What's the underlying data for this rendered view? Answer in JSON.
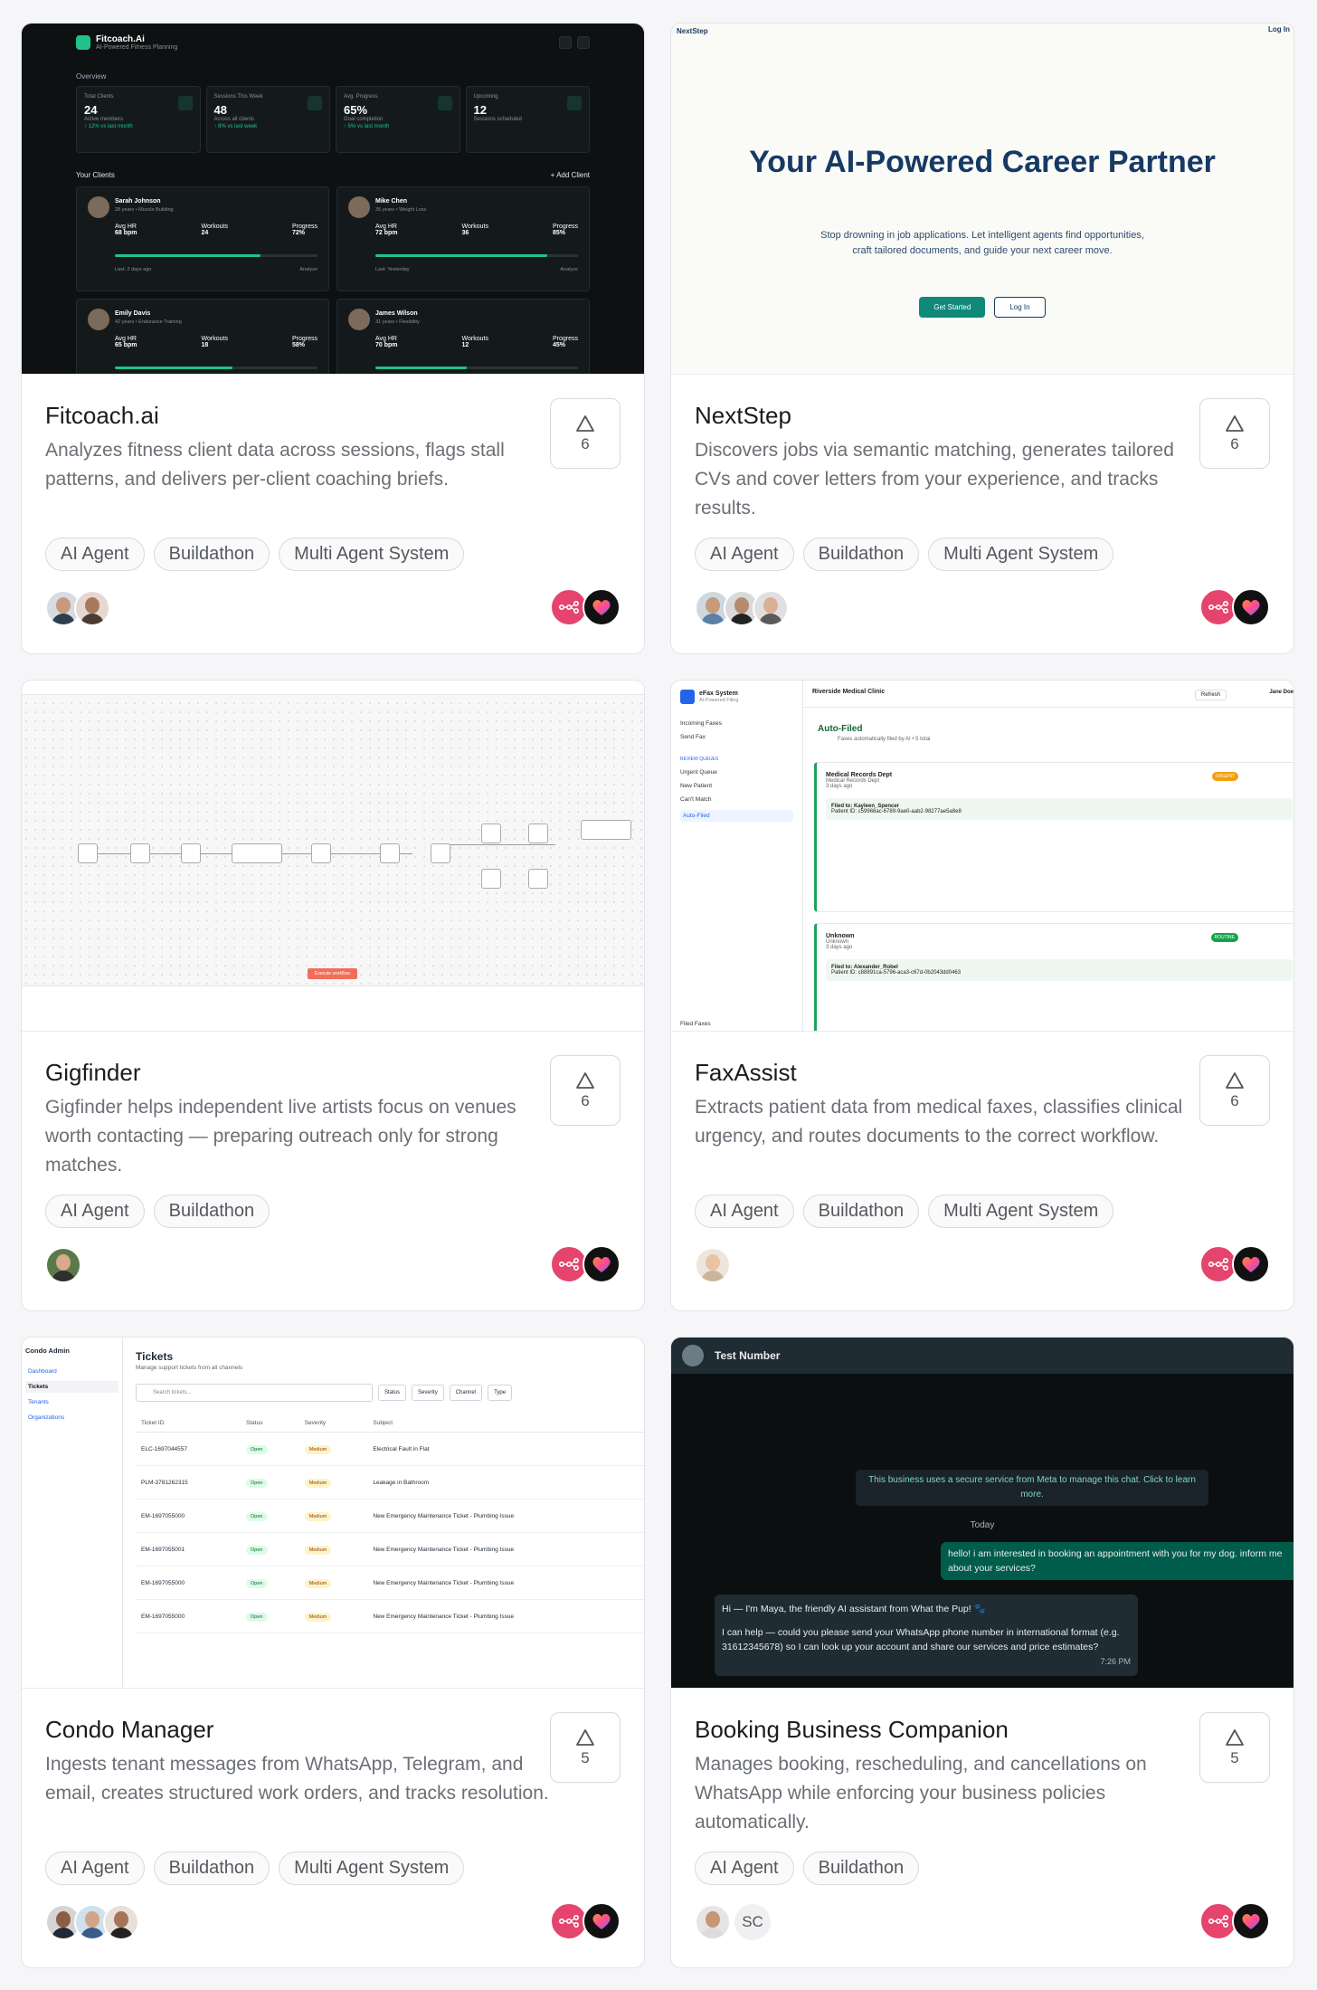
{
  "cards": [
    {
      "title": "Fitcoach.ai",
      "description": "Analyzes fitness client data across sessions, flags stall patterns, and delivers per-client coaching briefs.",
      "votes": "6",
      "tags": [
        "AI Agent",
        "Buildathon",
        "Multi Agent System"
      ],
      "shot": {
        "brand": "Fitcoach.Ai",
        "brand_sub": "AI-Powered Fitness Planning",
        "section": "Overview",
        "stats": [
          {
            "label": "Total Clients",
            "value": "24",
            "sub": "Active members",
            "trend": "↑ 12% vs last month"
          },
          {
            "label": "Sessions This Week",
            "value": "48",
            "sub": "Across all clients",
            "trend": "↑ 8% vs last week"
          },
          {
            "label": "Avg. Progress",
            "value": "65%",
            "sub": "Goal completion",
            "trend": "↑ 5% vs last month"
          },
          {
            "label": "Upcoming",
            "value": "12",
            "sub": "Sessions scheduled",
            "trend": ""
          }
        ],
        "clients_title": "Your Clients",
        "add_client": "+ Add Client",
        "clients": [
          {
            "name": "Sarah Johnson",
            "info": "28 years • Muscle Building",
            "hr": "68 bpm",
            "workouts": "24",
            "progress": "72%",
            "progress_value": 0.72,
            "last": "Last: 2 days ago"
          },
          {
            "name": "Mike Chen",
            "info": "35 years • Weight Loss",
            "hr": "72 bpm",
            "workouts": "36",
            "progress": "85%",
            "progress_value": 0.85,
            "last": "Last: Yesterday"
          },
          {
            "name": "Emily Davis",
            "info": "42 years • Endurance Training",
            "hr": "65 bpm",
            "workouts": "18",
            "progress": "58%",
            "progress_value": 0.58,
            "last": ""
          },
          {
            "name": "James Wilson",
            "info": "31 years • Flexibility",
            "hr": "70 bpm",
            "workouts": "12",
            "progress": "45%",
            "progress_value": 0.45,
            "last": ""
          }
        ],
        "labels": {
          "hr": "Avg HR",
          "workouts": "Workouts",
          "progress": "Progress",
          "analyze": "Analyze"
        }
      }
    },
    {
      "title": "NextStep",
      "description": "Discovers jobs via semantic matching, generates tailored CVs and cover letters from your experience, and tracks results.",
      "votes": "6",
      "tags": [
        "AI Agent",
        "Buildathon",
        "Multi Agent System"
      ],
      "shot": {
        "logo": "NextStep",
        "login_link": "Log In",
        "headline": "Your AI-Powered Career Partner",
        "subtext": "Stop drowning in job applications. Let intelligent agents find opportunities, craft tailored documents, and guide your next career move.",
        "primary": "Get Started",
        "secondary": "Log In"
      }
    },
    {
      "title": "Gigfinder",
      "description": "Gigfinder helps independent live artists focus on venues worth contacting — preparing outreach only for strong matches.",
      "votes": "6",
      "tags": [
        "AI Agent",
        "Buildathon"
      ],
      "shot": {
        "execute": "Execute workflow"
      }
    },
    {
      "title": "FaxAssist",
      "description": "Extracts patient data from medical faxes, classifies clinical urgency, and routes documents to the correct workflow.",
      "votes": "6",
      "tags": [
        "AI Agent",
        "Buildathon",
        "Multi Agent System"
      ],
      "shot": {
        "app": "eFax System",
        "app_sub": "AI-Powered Filing",
        "nav": [
          "Incoming Faxes",
          "Send Fax"
        ],
        "queue_label": "REVIEW QUEUES",
        "queues": [
          "Urgent Queue",
          "New Patient",
          "Can't Match",
          "Auto-Filed"
        ],
        "footer": "Filed Faxes",
        "clinic": "Riverside Medical Clinic",
        "refresh": "Refresh",
        "user": "Jane Doe",
        "heading": "Auto-Filed",
        "heading_sub": "Faxes automatically filed by AI • 5 total",
        "records": [
          {
            "dept": "Medical Records Dept",
            "sub": "Medical Records Dept",
            "age": "3 days ago",
            "filed": "Filed to: Kayleen_Spencer",
            "pid": "Patient ID: c59968ac-6789-9ae0-aab2-98277ae5a8e8",
            "pct": "98%",
            "tag": "URGENT"
          },
          {
            "dept": "Unknown",
            "sub": "Unknown",
            "age": "3 days ago",
            "filed": "Filed to: Alexander_Robel",
            "pid": "Patient ID: c88891ca-5796-aca3-c67d-0b2043dd0463",
            "pct": "100%",
            "tag": "ROUTINE"
          }
        ]
      }
    },
    {
      "title": "Condo Manager",
      "description": "Ingests tenant messages from WhatsApp, Telegram, and email, creates structured work orders, and tracks resolution.",
      "votes": "5",
      "tags": [
        "AI Agent",
        "Buildathon",
        "Multi Agent System"
      ],
      "shot": {
        "app": "Condo Admin",
        "nav": [
          "Dashboard",
          "Tickets",
          "Tenants",
          "Organizations"
        ],
        "title": "Tickets",
        "sub": "Manage support tickets from all channels",
        "search": "Search tickets...",
        "filters": [
          "Status",
          "Severity",
          "Channel",
          "Type"
        ],
        "columns": [
          "Ticket ID",
          "Status",
          "Severity",
          "Subject"
        ],
        "rows": [
          {
            "id": "ELC-1697044557",
            "status": "Open",
            "severity": "Medium",
            "subject": "Electrical Fault in Flat"
          },
          {
            "id": "PLM-3781262315",
            "status": "Open",
            "severity": "Medium",
            "subject": "Leakage in Bathroom"
          },
          {
            "id": "EM-1697055000",
            "status": "Open",
            "severity": "Medium",
            "subject": "New Emergency Maintenance Ticket - Plumbing Issue"
          },
          {
            "id": "EM-1697055001",
            "status": "Open",
            "severity": "Medium",
            "subject": "New Emergency Maintenance Ticket - Plumbing Issue"
          },
          {
            "id": "EM-1697055000",
            "status": "Open",
            "severity": "Medium",
            "subject": "New Emergency Maintenance Ticket - Plumbing Issue"
          },
          {
            "id": "EM-1697055000",
            "status": "Open",
            "severity": "Medium",
            "subject": "New Emergency Maintenance Ticket - Plumbing Issue"
          }
        ]
      }
    },
    {
      "title": "Booking Business Companion",
      "description": "Manages booking, rescheduling, and cancellations on WhatsApp while enforcing your business policies automatically.",
      "votes": "5",
      "tags": [
        "AI Agent",
        "Buildathon"
      ],
      "initials": "SC",
      "shot": {
        "contact": "Test Number",
        "system": "This business uses a secure service from Meta to manage this chat. Click to learn more.",
        "day": "Today",
        "outgoing": "hello! i am interested in booking an appointment with you for my dog. inform me about your services?",
        "incoming_1": "Hi — I'm Maya, the friendly AI assistant from What the Pup! 🐾",
        "incoming_2": "I can help — could you please send your WhatsApp phone number in international format (e.g. 31612345678) so I can look up your account and share our services and price estimates?",
        "time": "7:26 PM"
      }
    }
  ],
  "colors": {
    "vote_border": "#d8d9de",
    "logo_red": "#e5446d",
    "accent_green": "#1fc28b"
  }
}
